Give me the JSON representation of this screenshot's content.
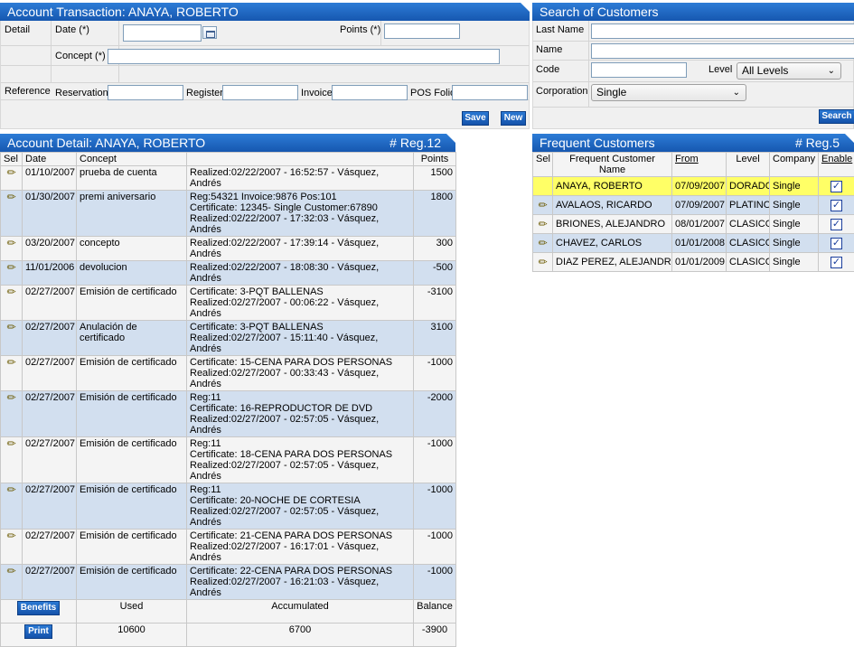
{
  "account_transaction": {
    "title": "Account Transaction: ANAYA, ROBERTO",
    "detail_label": "Detail",
    "date_label": "Date (*)",
    "points_label": "Points (*)",
    "concept_label": "Concept (*)",
    "reference_label": "Reference",
    "reservation_label": "Reservation",
    "register_label": "Register",
    "invoice_label": "Invoice",
    "pos_folio_label": "POS Folio",
    "save_label": "Save",
    "new_label": "New"
  },
  "search_customers": {
    "title": "Search of Customers",
    "last_name_label": "Last Name",
    "name_label": "Name",
    "code_label": "Code",
    "level_label": "Level",
    "level_value": "All Levels",
    "corporation_label": "Corporation",
    "corporation_value": "Single",
    "search_label": "Search"
  },
  "account_detail": {
    "title": "Account Detail: ANAYA, ROBERTO",
    "reg": "# Reg.12",
    "columns": [
      "Sel",
      "Date",
      "Concept",
      "",
      "Points"
    ],
    "rows": [
      {
        "date": "01/10/2007",
        "concept": "prueba de cuenta",
        "detail": "Realized:02/22/2007 - 16:52:57 - Vásquez, Andrés",
        "points": "1500"
      },
      {
        "date": "01/30/2007",
        "concept": "premi aniversario",
        "detail": "Reg:54321 Invoice:9876 Pos:101\nCertificate: 12345- Single Customer:67890\nRealized:02/22/2007 - 17:32:03 - Vásquez, Andrés",
        "points": "1800"
      },
      {
        "date": "03/20/2007",
        "concept": "concepto",
        "detail": "Realized:02/22/2007 - 17:39:14 - Vásquez, Andrés",
        "points": "300"
      },
      {
        "date": "11/01/2006",
        "concept": "devolucion",
        "detail": "Realized:02/22/2007 - 18:08:30 - Vásquez, Andrés",
        "points": "-500"
      },
      {
        "date": "02/27/2007",
        "concept": "Emisión de certificado",
        "detail": "Certificate: 3-PQT BALLENAS\nRealized:02/27/2007 - 00:06:22 - Vásquez, Andrés",
        "points": "-3100"
      },
      {
        "date": "02/27/2007",
        "concept": "Anulación de certificado",
        "detail": "Certificate: 3-PQT BALLENAS\nRealized:02/27/2007 - 15:11:40 - Vásquez, Andrés",
        "points": "3100"
      },
      {
        "date": "02/27/2007",
        "concept": "Emisión de certificado",
        "detail": "Certificate: 15-CENA PARA DOS PERSONAS\nRealized:02/27/2007 - 00:33:43 - Vásquez, Andrés",
        "points": "-1000"
      },
      {
        "date": "02/27/2007",
        "concept": "Emisión de certificado",
        "detail": "Reg:11\nCertificate: 16-REPRODUCTOR DE DVD\nRealized:02/27/2007 - 02:57:05 - Vásquez, Andrés",
        "points": "-2000"
      },
      {
        "date": "02/27/2007",
        "concept": "Emisión de certificado",
        "detail": "Reg:11\nCertificate: 18-CENA PARA DOS PERSONAS\nRealized:02/27/2007 - 02:57:05 - Vásquez, Andrés",
        "points": "-1000"
      },
      {
        "date": "02/27/2007",
        "concept": "Emisión de certificado",
        "detail": "Reg:11\nCertificate: 20-NOCHE DE CORTESIA\nRealized:02/27/2007 - 02:57:05 - Vásquez, Andrés",
        "points": "-1000"
      },
      {
        "date": "02/27/2007",
        "concept": "Emisión de certificado",
        "detail": "Certificate: 21-CENA PARA DOS PERSONAS\nRealized:02/27/2007 - 16:17:01 - Vásquez, Andrés",
        "points": "-1000"
      },
      {
        "date": "02/27/2007",
        "concept": "Emisión de certificado",
        "detail": "Certificate: 22-CENA PARA DOS PERSONAS\nRealized:02/27/2007 - 16:21:03 - Vásquez, Andrés",
        "points": "-1000"
      }
    ],
    "footer": {
      "benefits_label": "Benefits",
      "used_label": "Used",
      "accumulated_label": "Accumulated",
      "balance_label": "Balance",
      "print_label": "Print",
      "used": "10600",
      "accumulated": "6700",
      "balance": "-3900"
    }
  },
  "frequent_customers": {
    "title": "Frequent Customers",
    "reg": "# Reg.5",
    "columns": [
      "Sel",
      "Frequent Customer Name",
      "From",
      "Level",
      "Company",
      "Enable"
    ],
    "rows": [
      {
        "name": "ANAYA, ROBERTO",
        "from": "07/09/2007",
        "level": "DORADO",
        "company": "Single",
        "enabled": true
      },
      {
        "name": "AVALAOS, RICARDO",
        "from": "07/09/2007",
        "level": "PLATINO",
        "company": "Single",
        "enabled": true
      },
      {
        "name": "BRIONES, ALEJANDRO",
        "from": "08/01/2007",
        "level": "CLASICO",
        "company": "Single",
        "enabled": true
      },
      {
        "name": "CHAVEZ, CARLOS",
        "from": "01/01/2008",
        "level": "CLASICO",
        "company": "Single",
        "enabled": true
      },
      {
        "name": "DIAZ PEREZ, ALEJANDRO",
        "from": "01/01/2009",
        "level": "CLASICO",
        "company": "Single",
        "enabled": true
      }
    ]
  },
  "colors": {
    "title_bar": "#1a63c0",
    "row_alt": "#d2dfef",
    "row_highlight": "#ffff66"
  }
}
